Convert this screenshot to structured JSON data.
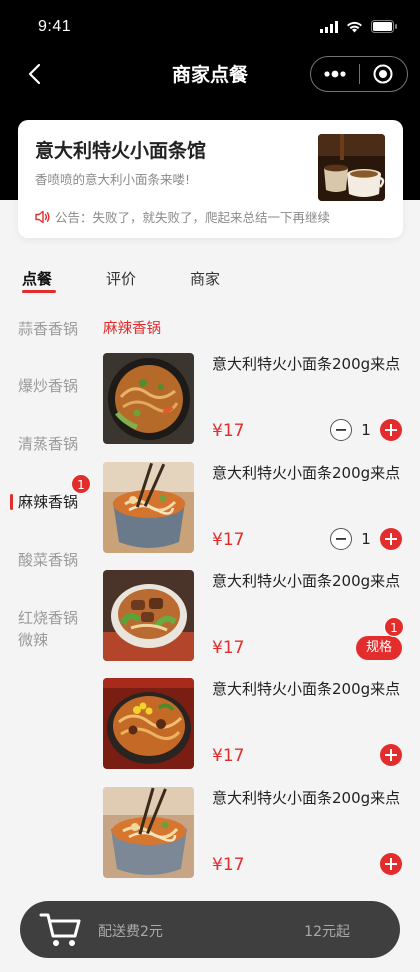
{
  "status_bar": {
    "time": "9:41"
  },
  "nav": {
    "title": "商家点餐"
  },
  "shop": {
    "name": "意大利特火小面条馆",
    "slogan": "香喷喷的意大利小面条来喽!",
    "notice": "公告：失败了，就失败了，爬起来总结一下再继续"
  },
  "tabs": [
    "点餐",
    "评价",
    "商家"
  ],
  "sidebar": {
    "items": [
      {
        "label": "蒜香香锅"
      },
      {
        "label": "爆炒香锅"
      },
      {
        "label": "清蒸香锅"
      },
      {
        "label": "麻辣香锅",
        "badge": "1"
      },
      {
        "label": "酸菜香锅"
      },
      {
        "label": "红烧香锅\n微辣"
      }
    ]
  },
  "category": {
    "title": "麻辣香锅"
  },
  "products": [
    {
      "name": "意大利特火小面条200g来点",
      "price": "¥17",
      "qty": "1"
    },
    {
      "name": "意大利特火小面条200g来点",
      "price": "¥17",
      "qty": "1"
    },
    {
      "name": "意大利特火小面条200g来点",
      "price": "¥17",
      "spec_label": "规格",
      "spec_badge": "1"
    },
    {
      "name": "意大利特火小面条200g来点",
      "price": "¥17"
    },
    {
      "name": "意大利特火小面条200g来点",
      "price": "¥17"
    }
  ],
  "cart": {
    "delivery_fee": "配送费2元",
    "min_order": "12元起"
  },
  "colors": {
    "accent": "#e32c2c",
    "header_bg": "#000000",
    "cart_bg": "#3f3f3f"
  }
}
